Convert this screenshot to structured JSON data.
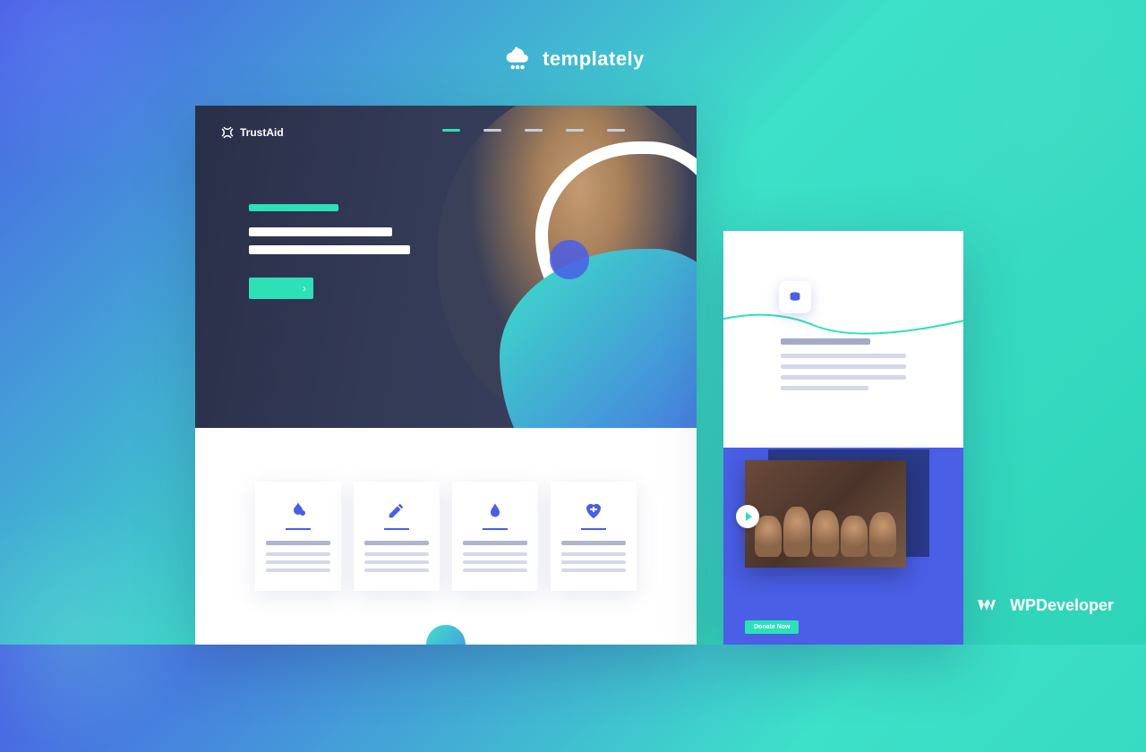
{
  "brand_top": {
    "name": "templately"
  },
  "brand_bottom": {
    "name": "WPDeveloper"
  },
  "main_template": {
    "site_name": "TrustAid",
    "nav_items": 5,
    "feature_icons": [
      "leaf-icon",
      "pencil-icon",
      "water-drop-icon",
      "heart-plus-icon"
    ]
  },
  "side_template": {
    "badge_icon": "coins-icon",
    "cta_label": "Donate Now"
  }
}
